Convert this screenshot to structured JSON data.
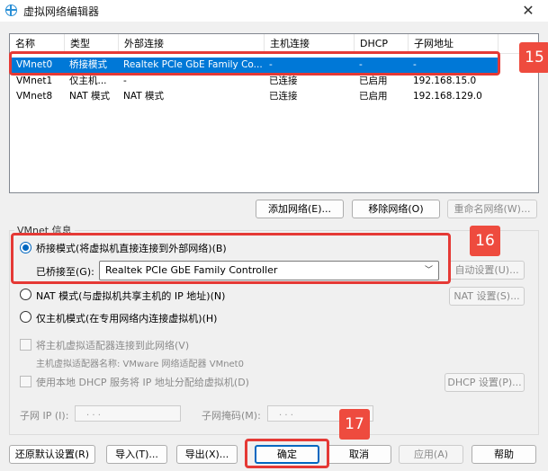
{
  "window": {
    "title": "虚拟网络编辑器",
    "close_glyph": "✕",
    "icon": "vmware-globe-icon"
  },
  "network_list": {
    "columns": [
      "名称",
      "类型",
      "外部连接",
      "主机连接",
      "DHCP",
      "子网地址"
    ],
    "rows": [
      {
        "name": "VMnet0",
        "type": "桥接模式",
        "external": "Realtek PCIe GbE Family Co...",
        "host": "-",
        "dhcp": "-",
        "subnet": "-",
        "selected": true
      },
      {
        "name": "VMnet1",
        "type": "仅主机...",
        "external": "-",
        "host": "已连接",
        "dhcp": "已启用",
        "subnet": "192.168.15.0",
        "selected": false
      },
      {
        "name": "VMnet8",
        "type": "NAT 模式",
        "external": "NAT 模式",
        "host": "已连接",
        "dhcp": "已启用",
        "subnet": "192.168.129.0",
        "selected": false
      }
    ]
  },
  "list_buttons": {
    "add": "添加网络(E)...",
    "remove": "移除网络(O)",
    "rename": "重命名网络(W)..."
  },
  "vmnet_info": {
    "group_title": "VMnet 信息",
    "bridged_label": "桥接模式(将虚拟机直接连接到外部网络)(B)",
    "bridged_to_label": "已桥接至(G):",
    "bridged_to_value": "Realtek PCIe GbE Family Controller",
    "auto_settings": "自动设置(U)...",
    "nat_label": "NAT 模式(与虚拟机共享主机的 IP 地址)(N)",
    "nat_settings": "NAT 设置(S)...",
    "host_only_label": "仅主机模式(在专用网络内连接虚拟机)(H)",
    "connect_host_adapter": "将主机虚拟适配器连接到此网络(V)",
    "host_adapter_name": "主机虚拟适配器名称: VMware 网络适配器 VMnet0",
    "use_dhcp": "使用本地 DHCP 服务将 IP 地址分配给虚拟机(D)",
    "dhcp_settings": "DHCP 设置(P)...",
    "subnet_ip_label": "子网 IP (I):",
    "subnet_mask_label": "子网掩码(M):",
    "ip_dots": ".        .        ."
  },
  "footer": {
    "restore": "还原默认设置(R)",
    "import": "导入(T)...",
    "export": "导出(X)...",
    "ok": "确定",
    "cancel": "取消",
    "apply": "应用(A)",
    "help": "帮助"
  },
  "annotations": {
    "badge_15": "15",
    "badge_16": "16",
    "badge_17": "17"
  },
  "colors": {
    "selection": "#0078d7",
    "annotation_red": "#e53935",
    "radio_accent": "#0067c0"
  }
}
